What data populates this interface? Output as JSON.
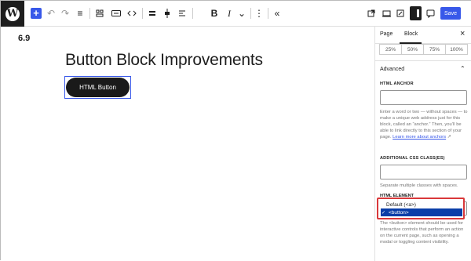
{
  "toolbar": {
    "add_label": "+",
    "undo": "↶",
    "redo": "↷",
    "list_view": "≡",
    "save_label": "Save",
    "bold": "B",
    "italic": "I",
    "more_chevron": "⌄",
    "options": "⋮",
    "collapse": "«"
  },
  "canvas": {
    "version": "6.9",
    "title": "Button Block Improvements",
    "button_text": "HTML Button"
  },
  "sidebar": {
    "tabs": [
      "Page",
      "Block"
    ],
    "active_tab": "Block",
    "width_options": [
      "25%",
      "50%",
      "75%",
      "100%"
    ],
    "advanced_title": "Advanced",
    "html_anchor_label": "HTML ANCHOR",
    "html_anchor_value": "",
    "html_anchor_help": "Enter a word or two — without spaces — to make a unique web address just for this block, called an “anchor.” Then, you’ll be able to link directly to this section of your page.",
    "learn_more": "Learn more about anchors",
    "css_class_label": "ADDITIONAL CSS CLASS(ES)",
    "css_class_value": "",
    "css_class_help": "Separate multiple classes with spaces.",
    "html_element_label": "HTML ELEMENT",
    "html_element_options": [
      "Default (<a>)",
      "<button>"
    ],
    "html_element_selected": "<button>",
    "html_element_help": "The <button> element should be used for interactive controls that perform an action on the current page, such as opening a modal or toggling content visibility."
  },
  "colors": {
    "accent": "#3858e9",
    "highlight": "#d9383a",
    "selected_option": "#0a3ea8"
  }
}
